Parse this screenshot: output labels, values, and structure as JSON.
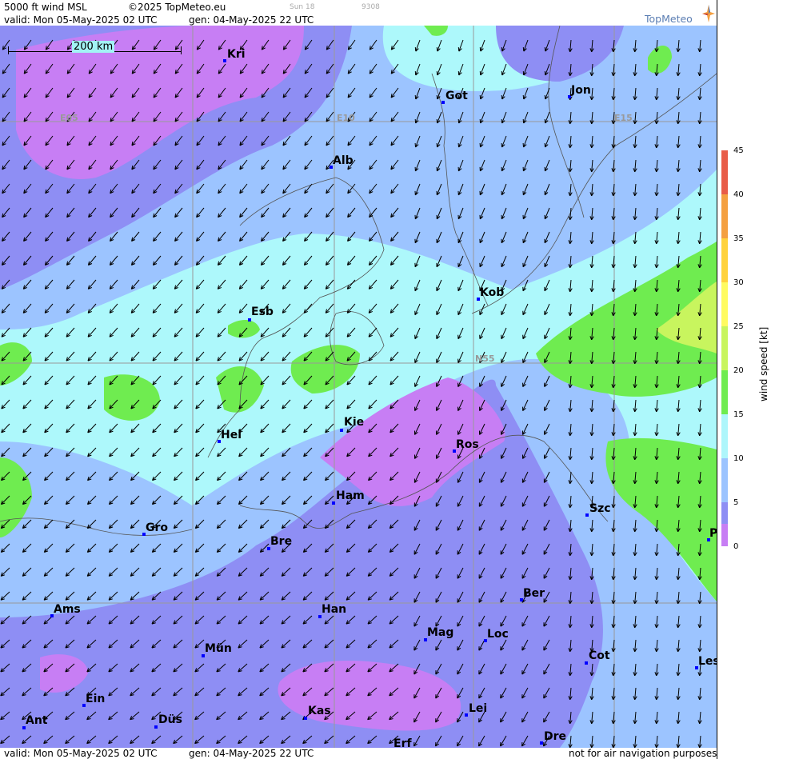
{
  "header": {
    "title": "5000 ft wind MSL",
    "copyright": "©2025 TopMeteo.eu",
    "sun": "Sun 18",
    "code": "9308",
    "valid": "valid:  Mon  05-May-2025  02 UTC",
    "gen": "gen: 04-May-2025 22 UTC",
    "logo_text": "TopMeteo"
  },
  "footer": {
    "valid": "valid:  Mon  05-May-2025  02 UTC",
    "gen": "gen: 04-May-2025 22 UTC",
    "disclaimer": "not for air navigation purposes"
  },
  "scale": {
    "label": "200 km"
  },
  "grid_labels": [
    "E05",
    "E10",
    "E15",
    "N55"
  ],
  "cities": [
    "Kri",
    "Got",
    "Jon",
    "Alb",
    "Esb",
    "Kob",
    "Kie",
    "Hel",
    "Ros",
    "Ham",
    "Gro",
    "Bre",
    "Szc",
    "P",
    "Ber",
    "Ams",
    "Han",
    "Mag",
    "Loc",
    "Mün",
    "Cot",
    "Les",
    "Ein",
    "Kas",
    "Lei",
    "Ant",
    "Düs",
    "Dre",
    "Erf"
  ],
  "legend": {
    "unit_label": "wind speed [kt]",
    "ticks": [
      "45",
      "40",
      "35",
      "30",
      "25",
      "20",
      "15",
      "10",
      "5",
      "0"
    ],
    "colors": [
      "#e85c48",
      "#f4a040",
      "#ffd23c",
      "#fffb60",
      "#c8f55e",
      "#6fec50",
      "#aef6fb",
      "#9cc4ff",
      "#8e8ef4",
      "#c77ef4"
    ]
  },
  "colors": {
    "calm": "#c77ef4",
    "light": "#8e8ef4",
    "moderate": "#9cc4ff",
    "fresh": "#aef6fb",
    "strong": "#6fec50",
    "stronger": "#c8f55e"
  }
}
